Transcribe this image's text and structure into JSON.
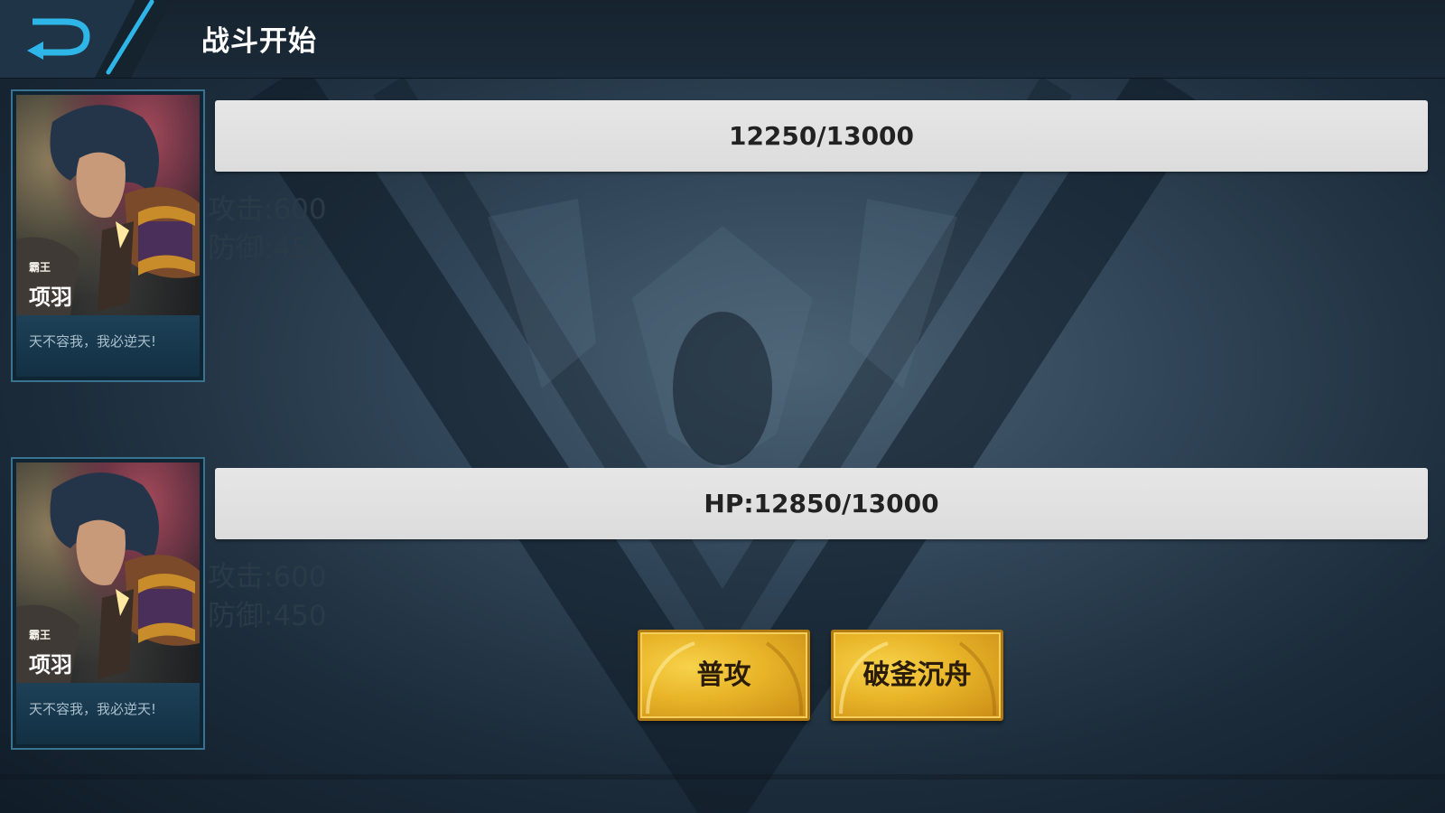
{
  "header": {
    "title": "战斗开始",
    "back_icon": "back-arrow-icon"
  },
  "player_top": {
    "hero_epithet": "霸王",
    "hero_name": "项羽",
    "hero_quote": "天不容我，我必逆天!",
    "hp_text": "12250/13000",
    "hp_current": 12250,
    "hp_max": 13000,
    "attack": "攻击:600",
    "defense": "防御:450"
  },
  "player_bottom": {
    "hero_epithet": "霸王",
    "hero_name": "项羽",
    "hero_quote": "天不容我，我必逆天!",
    "hp_text": "HP:12850/13000",
    "hp_current": 12850,
    "hp_max": 13000,
    "attack": "攻击:600",
    "defense": "防御:450"
  },
  "actions": {
    "normal_attack": "普攻",
    "skill": "破釜沉舟"
  },
  "colors": {
    "accent": "#2fb6e8",
    "button_gold": "#e8b428",
    "hp_bar": "#e2e2e2",
    "card_border": "#3a7390"
  }
}
